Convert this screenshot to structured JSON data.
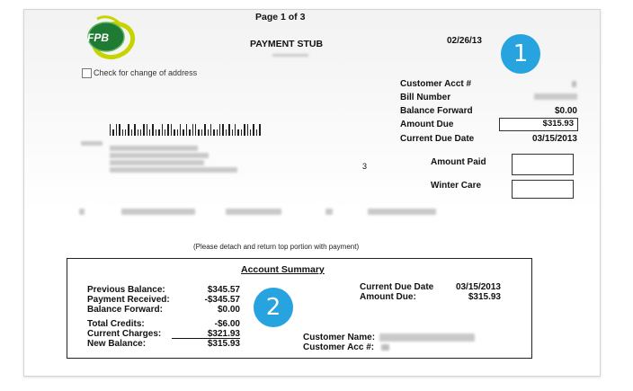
{
  "logo": {
    "text": "FPB"
  },
  "header": {
    "page": "Page 1 of 3",
    "title": "PAYMENT STUB",
    "date": "02/26/13"
  },
  "address_change": {
    "label": "Check for change of address"
  },
  "account_info": {
    "labels": [
      "Customer Acct #",
      "Bill Number",
      "Balance Forward",
      "Amount Due",
      "Current Due Date"
    ],
    "balance_forward": "$0.00",
    "amount_due": "$315.93",
    "current_due_date": "03/15/2013"
  },
  "misc_number": "3",
  "payment_fields": {
    "amount_paid": "Amount Paid",
    "winter_care": "Winter Care"
  },
  "detach_note": "(Please detach and return top portion with payment)",
  "badges": {
    "one": "1",
    "two": "2"
  },
  "summary": {
    "title": "Account Summary",
    "rows": [
      {
        "label": "Previous Balance:",
        "value": "$345.57"
      },
      {
        "label": "Payment Received:",
        "value": "-$345.57"
      },
      {
        "label": "Balance Forward:",
        "value": "$0.00"
      },
      {
        "label": "Total Credits:",
        "value": "-$6.00"
      },
      {
        "label": "Current Charges:",
        "value": "$321.93"
      },
      {
        "label": "New Balance:",
        "value": "$315.93"
      }
    ],
    "due_date_label": "Current Due Date",
    "due_date_value": "03/15/2013",
    "amount_due_label": "Amount Due:",
    "amount_due_value": "$315.93",
    "customer_name_label": "Customer Name:",
    "customer_acc_label": "Customer Acc #:"
  },
  "colors": {
    "badge": "#27a3df",
    "logo_green": "#2f8f3a",
    "logo_yellow": "#c8d400"
  }
}
